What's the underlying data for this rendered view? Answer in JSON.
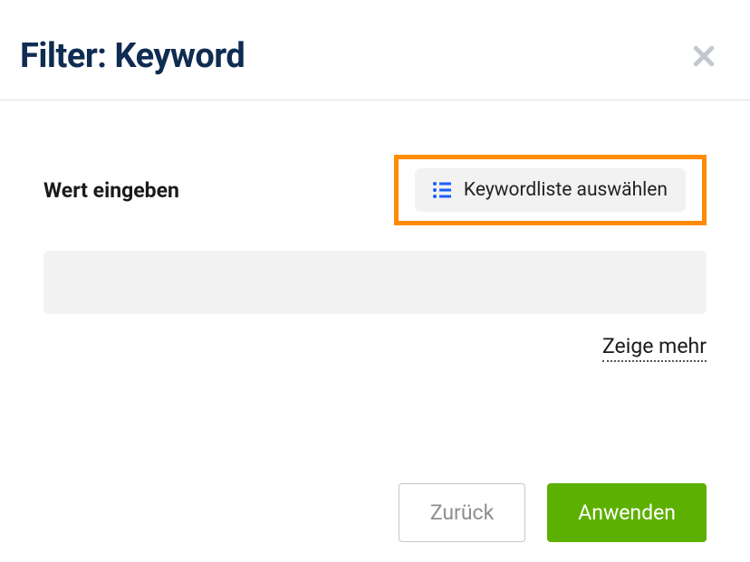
{
  "header": {
    "title": "Filter: Keyword"
  },
  "form": {
    "input_label": "Wert eingeben",
    "select_list_label": "Keywordliste auswählen",
    "input_value": "",
    "show_more": "Zeige mehr"
  },
  "actions": {
    "back": "Zurück",
    "apply": "Anwenden"
  }
}
